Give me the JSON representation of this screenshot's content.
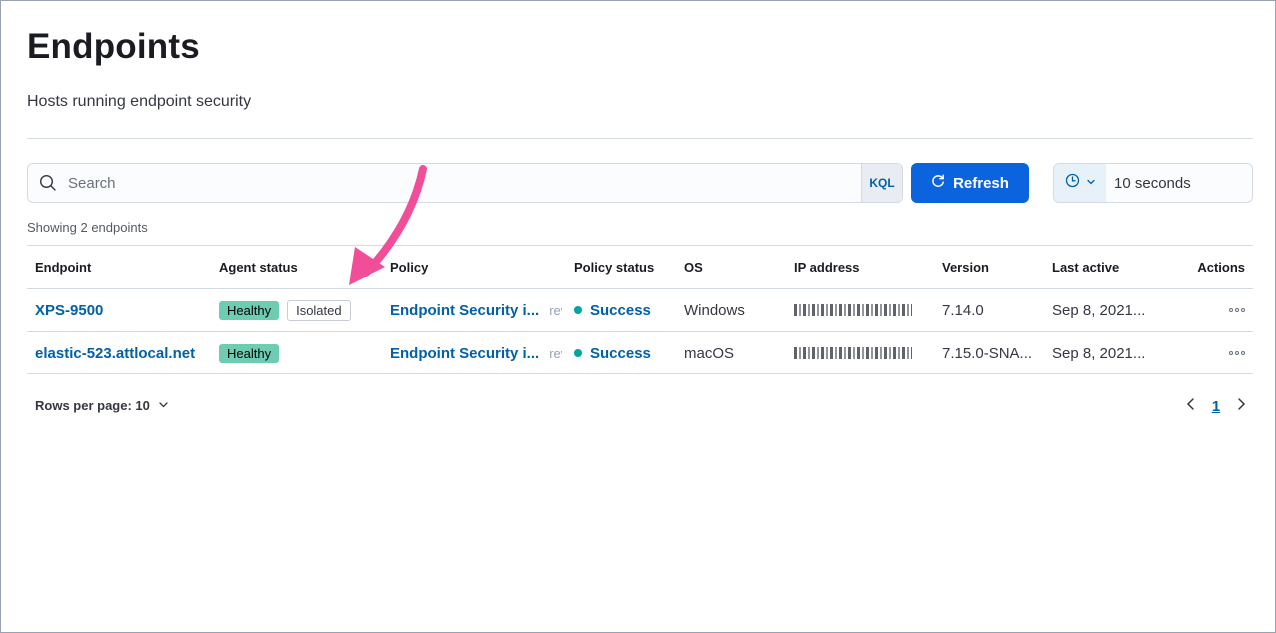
{
  "header": {
    "title": "Endpoints",
    "subtitle": "Hosts running endpoint security"
  },
  "search": {
    "placeholder": "Search",
    "kql_label": "KQL"
  },
  "refresh": {
    "label": "Refresh"
  },
  "interval": {
    "value": "10 seconds"
  },
  "summary": {
    "showing": "Showing 2 endpoints"
  },
  "table": {
    "columns": [
      "Endpoint",
      "Agent status",
      "Policy",
      "Policy status",
      "OS",
      "IP address",
      "Version",
      "Last active",
      "Actions"
    ],
    "rows": [
      {
        "endpoint": "XPS-9500",
        "agent_status": "Healthy",
        "isolation": "Isolated",
        "policy": "Endpoint Security i...",
        "policy_rev": "rev",
        "policy_status": "Success",
        "os": "Windows",
        "version": "7.14.0",
        "last_active": "Sep 8, 2021..."
      },
      {
        "endpoint": "elastic-523.attlocal.net",
        "agent_status": "Healthy",
        "policy": "Endpoint Security i...",
        "policy_rev": "rev",
        "policy_status": "Success",
        "os": "macOS",
        "version": "7.15.0-SNA...",
        "last_active": "Sep 8, 2021..."
      }
    ]
  },
  "pagination": {
    "rows_per_page": "Rows per page: 10",
    "current_page": "1"
  },
  "colors": {
    "primary": "#0b64dd",
    "link": "#0061a6",
    "healthy": "#6dccb1",
    "success_dot": "#00a69b",
    "annotation_arrow": "#f04e98"
  },
  "icons": {
    "search": "search-icon",
    "refresh": "refresh-icon",
    "clock": "clock-icon",
    "chevron": "chevron-down-icon",
    "actions": "dots-horizontal-icon",
    "prev": "chevron-left-icon",
    "next": "chevron-right-icon",
    "annotation": "arrow-annotation-icon"
  }
}
